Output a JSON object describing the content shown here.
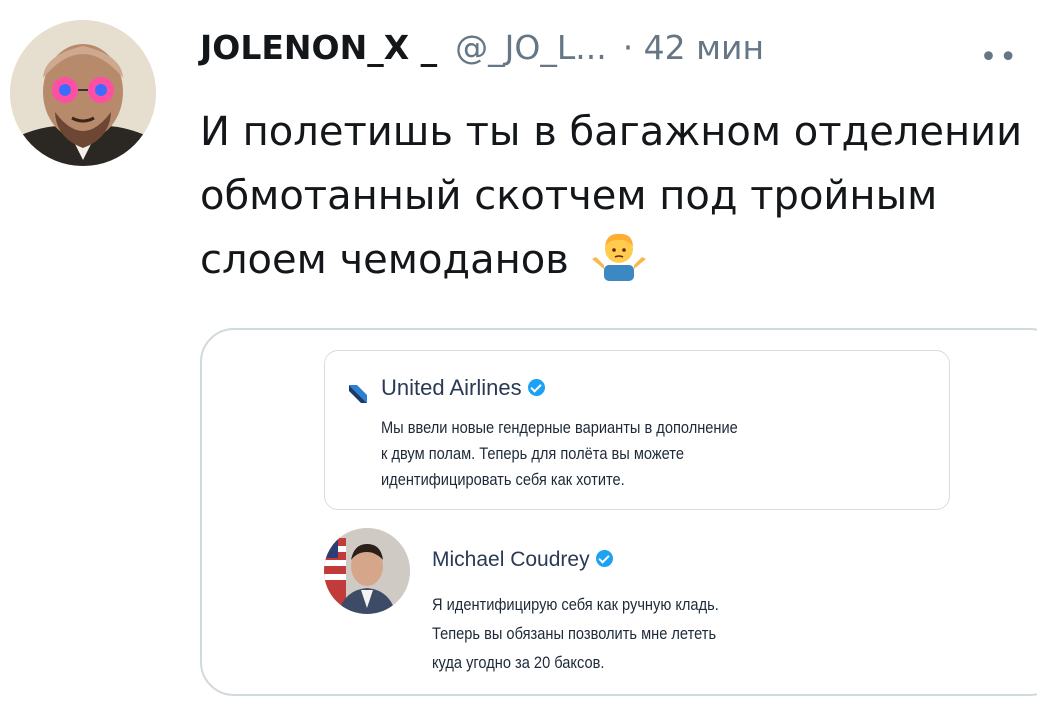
{
  "tweet": {
    "author_name": "JOLENON_X _",
    "handle": "@_JO_L...",
    "time": "· 42 мин",
    "more_label": "••",
    "text": "И полетишь ты в багажном отделении обмотанный скотчем под тройным слоем чемоданов",
    "emoji": "person-shrugging-emoji"
  },
  "card": {
    "post1": {
      "author": "United Airlines",
      "icon": "united-airlines-logo",
      "text_lines": [
        "Мы ввели новые гендерные варианты в дополнение",
        "к двум полам. Теперь для полёта вы можете",
        "идентифицировать себя как хотите."
      ]
    },
    "post2": {
      "author": "Michael Coudrey",
      "text_lines": [
        "Я идентифицирую себя как ручную кладь.",
        "Теперь вы обязаны позволить мне лететь",
        "куда угодно за 20 баксов."
      ]
    }
  },
  "colors": {
    "verified": "#1da1f2",
    "secondary_text": "#657786",
    "border": "#cfd9de"
  }
}
